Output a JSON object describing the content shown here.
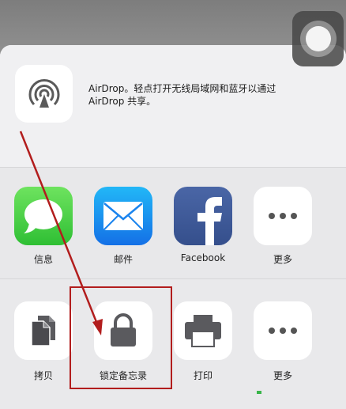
{
  "airdrop": {
    "line1": "AirDrop。轻点打开无线局域网和蓝牙以通过",
    "line2": "AirDrop 共享。"
  },
  "apps": [
    {
      "label": "信息",
      "icon": "messages-icon"
    },
    {
      "label": "邮件",
      "icon": "mail-icon"
    },
    {
      "label": "Facebook",
      "icon": "facebook-icon"
    },
    {
      "label": "更多",
      "icon": "more-icon"
    }
  ],
  "actions": [
    {
      "label": "拷贝",
      "icon": "copy-icon"
    },
    {
      "label": "锁定备忘录",
      "icon": "lock-icon"
    },
    {
      "label": "打印",
      "icon": "printer-icon"
    },
    {
      "label": "更多",
      "icon": "more-icon"
    }
  ],
  "colors": {
    "annotation": "#b21d1d",
    "messages": "#2fbf34",
    "mail": "#1470e6",
    "facebook": "#3b5998"
  }
}
